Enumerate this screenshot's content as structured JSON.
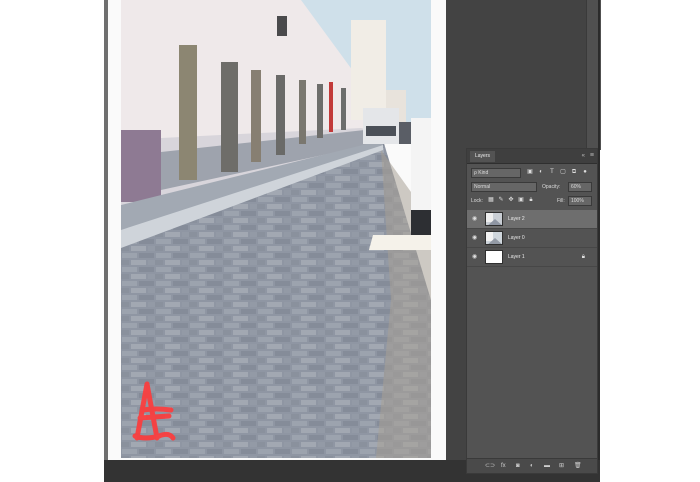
{
  "layers_panel": {
    "tab_label": "Layers",
    "collapse_glyph": "«",
    "menu_glyph": "≡",
    "filter": {
      "kind_label": "ρ Kind"
    },
    "blend_mode": "Normal",
    "opacity_label": "Opacity:",
    "opacity_value": "60%",
    "lock_label": "Lock:",
    "fill_label": "Fill:",
    "fill_value": "100%",
    "layers": [
      {
        "name": "Layer 2",
        "selected": true
      },
      {
        "name": "Layer 0",
        "selected": false
      },
      {
        "name": "Layer 1",
        "selected": false
      }
    ]
  },
  "canvas": {
    "annotation_letter": "A"
  },
  "colors": {
    "workspace": "#434343",
    "panel": "#535353",
    "selected_row": "#6e6e6e",
    "annotation_red": "#ff3a3a"
  }
}
